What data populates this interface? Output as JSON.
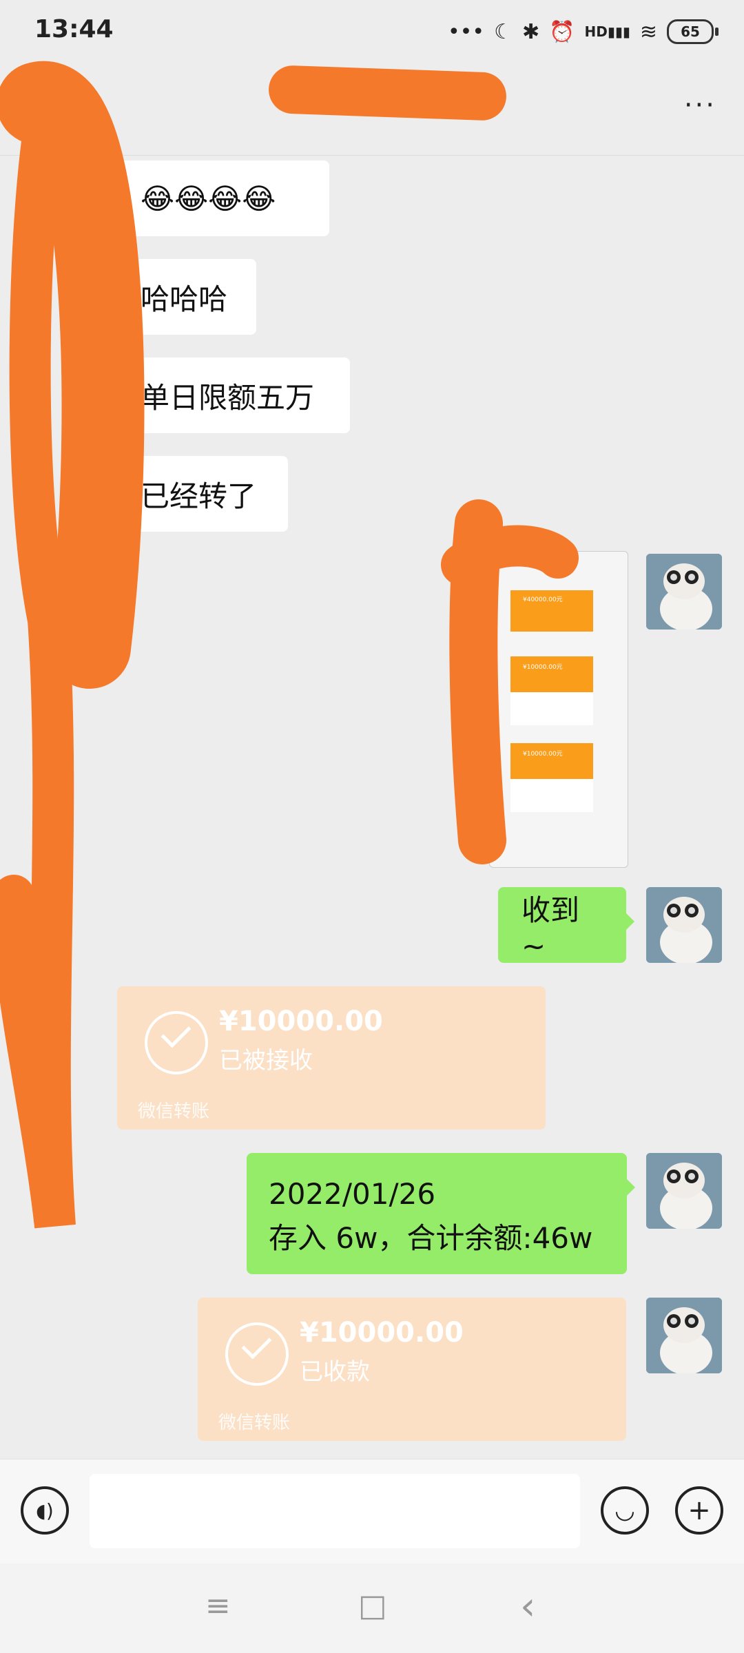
{
  "status_bar": {
    "time": "13:44",
    "battery": "65",
    "network": "HD"
  },
  "header": {
    "more_label": "···"
  },
  "messages": {
    "left": [
      {
        "text": "😂😂😂😂"
      },
      {
        "text": "哈哈哈"
      },
      {
        "text": "单日限额五万"
      },
      {
        "text": "已经转了"
      }
    ],
    "right_received": {
      "text": "收到 ~"
    },
    "transfer_in": {
      "amount": "¥10000.00",
      "status": "已被接收",
      "brand": "微信转账"
    },
    "note": {
      "line1": "2022/01/26",
      "line2": "存入 6w，合计余额:46w"
    },
    "transfer_out": {
      "amount": "¥10000.00",
      "status": "已收款",
      "brand": "微信转账"
    }
  },
  "screenshot_thumb": {
    "rows": [
      "¥40000.00元",
      "¥10000.00元",
      "¥10000.00元"
    ]
  },
  "input_bar": {
    "voice_icon": "voice-icon",
    "emoji_icon": "emoji-icon",
    "plus_icon": "plus-icon"
  },
  "nav_bar": {
    "menu_icon": "≡",
    "home_icon": "□",
    "back_icon": "‹"
  },
  "colors": {
    "bubble_green": "#95ec69",
    "transfer_bg": "#fbe0c5",
    "redaction": "#f5792a"
  }
}
